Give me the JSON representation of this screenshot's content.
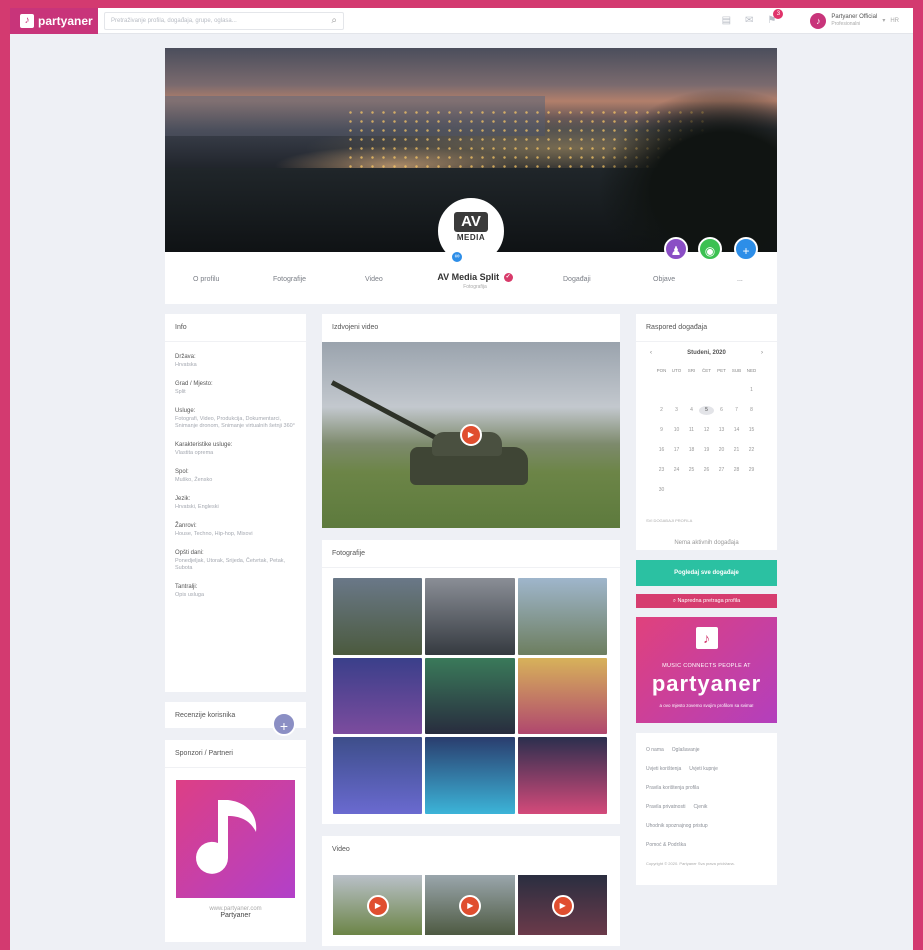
{
  "topbar": {
    "logo": "partyaner",
    "search_placeholder": "Pretraživanje profila, događaja, grupe, oglasa...",
    "notifications_count": "3",
    "user_name": "Partyaner Official",
    "user_sub": "Profesionalni",
    "lang": "HR"
  },
  "profile": {
    "name": "AV Media Split",
    "type": "Fotografija",
    "avatar_line1": "AV",
    "avatar_line2": "MEDIA",
    "nav": [
      "O profilu",
      "Fotografije",
      "Video",
      "Događaji",
      "Objave",
      "..."
    ]
  },
  "info": {
    "title": "Info",
    "items": [
      {
        "k": "Država:",
        "v": "Hrvatska"
      },
      {
        "k": "Grad / Mjesto:",
        "v": "Split"
      },
      {
        "k": "Usluge:",
        "v": "Fotografi, Video, Produkcija, Dokumentarci, Snimanje dronom, Snimanje virtualnih šetnji 360°"
      },
      {
        "k": "Karakteristike usluge:",
        "v": "Vlastita oprema"
      },
      {
        "k": "Spol:",
        "v": "Muško, Žensko"
      },
      {
        "k": "Jezik:",
        "v": "Hrvatski, Engleski"
      },
      {
        "k": "Žanrovi:",
        "v": "House, Techno, Hip-hop, Mixovi"
      },
      {
        "k": "Opšti dani:",
        "v": "Ponedjeljak, Utorak, Srijeda, Četvrtak, Petak, Subota"
      },
      {
        "k": "Tantralji:",
        "v": "Opis usluga"
      }
    ]
  },
  "reviews": {
    "title": "Recenzije korisnika",
    "add": "+"
  },
  "sponsor": {
    "title": "Sponzori / Partneri",
    "note": "www.partyaner.com",
    "name": "Partyaner"
  },
  "featured_video": {
    "title": "Izdvojeni video"
  },
  "photos": {
    "title": "Fotografije"
  },
  "videos": {
    "title": "Video"
  },
  "calendar": {
    "title": "Raspored događaja",
    "month": "Studeni, 2020",
    "prev": "‹",
    "next": "›",
    "dow": [
      "PON",
      "UTO",
      "SRI",
      "ČET",
      "PET",
      "SUB",
      "NED"
    ],
    "days": [
      "",
      "",
      "",
      "",
      "",
      "",
      "1",
      "2",
      "3",
      "4",
      "5",
      "6",
      "7",
      "8",
      "9",
      "10",
      "11",
      "12",
      "13",
      "14",
      "15",
      "16",
      "17",
      "18",
      "19",
      "20",
      "21",
      "22",
      "23",
      "24",
      "25",
      "26",
      "27",
      "28",
      "29",
      "30"
    ],
    "today": "5",
    "sub_label": "SVI DOGAĐAJI PROFILA",
    "empty": "Nema aktivnih događaja"
  },
  "buttons": {
    "green": "Pogledaj sve događaje",
    "pink": "Napredna pretraga profila"
  },
  "promo": {
    "mark": "♪",
    "tagline": "MUSIC CONNECTS PEOPLE AT",
    "word": "partyaner",
    "sub": "a ovo mjesto zovemo svojim profilom sa svima!"
  },
  "footer_links": [
    [
      "O nama",
      "Oglašavanje"
    ],
    [
      "Uvjeti korištenja",
      "Uvjeti kupnje"
    ],
    [
      "Pravila korištenja profila"
    ],
    [
      "Pravila privatnosti",
      "Cjenik"
    ],
    [
      "Uhodnik spoznajnog pristup"
    ],
    [
      "Pomoć & Podrška"
    ]
  ],
  "copyright": "Copyright © 2020. Partyaner Sva prava pridržana.",
  "colors": {
    "brand": "#d33a70",
    "accent_green": "#2bc1a2",
    "accent_blue": "#2d8ee8"
  }
}
